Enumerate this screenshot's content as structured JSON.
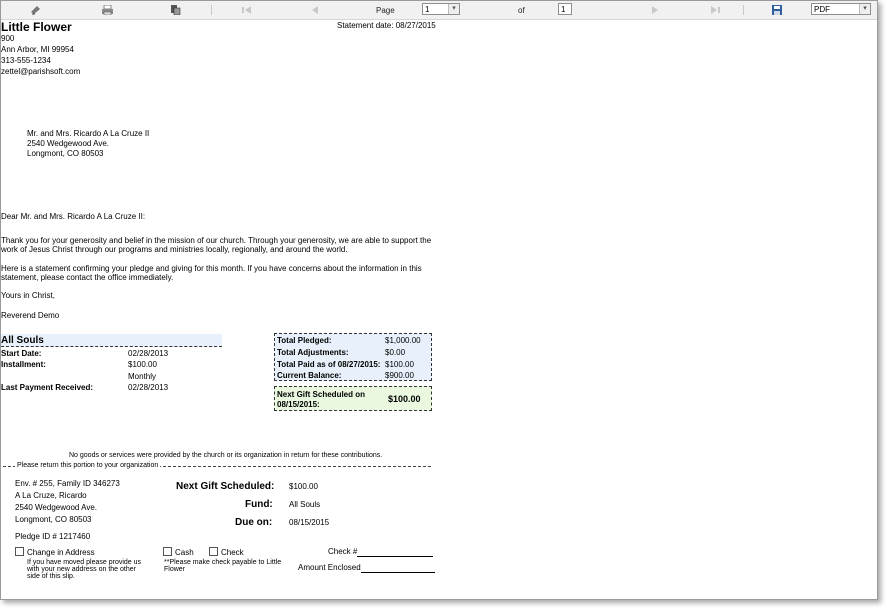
{
  "toolbar": {
    "page_label": "Page",
    "page_value": "1",
    "of_label": "of",
    "total_pages": "1",
    "export_format": "PDF"
  },
  "church": {
    "name": "Little Flower",
    "address1": "900",
    "city": "Ann Arbor, MI 99954",
    "phone": "313-555-1234",
    "email": "zettel@parishsoft.com"
  },
  "statement_date": "Statement date: 08/27/2015",
  "recipient": {
    "name": "Mr. and Mrs. Ricardo A La Cruze II",
    "street": "2540 Wedgewood Ave.",
    "city": "Longmont, CO 80503"
  },
  "letter": {
    "salutation": "Dear Mr. and Mrs. Ricardo A La Cruze II:",
    "para1_line1": "Thank you for your generosity and belief in the mission of our church. Through your generosity, we are able to support the",
    "para1_line2": "work of Jesus Christ through our programs and ministries locally, regionally, and around the world.",
    "para2_line1": "Here is a  statement confirming your pledge and giving for this month. If you have concerns about the information in this",
    "para2_line2": "statement, please contact the office immediately.",
    "closing": "Yours in Christ,",
    "signature": "Reverend Demo"
  },
  "fund_section": {
    "title": "All Souls",
    "start_date_label": "Start Date:",
    "start_date": "02/28/2013",
    "installment_label": "Installment:",
    "installment": "$100.00",
    "frequency": "Monthly",
    "last_payment_label": "Last Payment Received:",
    "last_payment": "02/28/2013"
  },
  "summary": {
    "total_pledged_label": "Total Pledged:",
    "total_pledged": "$1,000.00",
    "adjustments_label": "Total Adjustments:",
    "adjustments": "$0.00",
    "total_paid_label": "Total Paid as of 08/27/2015:",
    "total_paid": "$100.00",
    "balance_label": "Current Balance:",
    "balance": "$900.00",
    "next_gift_label_1": "Next Gift Scheduled on",
    "next_gift_label_2": "08/15/2015:",
    "next_gift": "$100.00"
  },
  "notice": "No goods or services were provided by the church or its organization in return for these contributions.",
  "tear_label": "Please return this portion to your organization",
  "slip": {
    "env": "Env. # 255, Family ID 346273",
    "name": "A La Cruze, Ricardo",
    "street": "2540 Wedgewood Ave.",
    "city": "Longmont, CO 80503",
    "pledge_id": "Pledge ID # 1217460",
    "next_gift_label": "Next Gift Scheduled:",
    "next_gift_value": "$100.00",
    "fund_label": "Fund:",
    "fund_value": "All Souls",
    "due_label": "Due on:",
    "due_value": "08/15/2015",
    "change_address": "Change in Address",
    "cash": "Cash",
    "check": "Check",
    "check_num_label": "Check #",
    "moved_note_1": "If you have moved please provide us",
    "moved_note_2": "with your new address on the other",
    "moved_note_3": "side of this slip.",
    "payable_note_1": "**Please make check payable to Little",
    "payable_note_2": "Flower",
    "amount_label": "Amount Enclosed"
  },
  "colors": {
    "summary_bg": "#e8f1fb",
    "next_gift_bg": "#eaf8e0",
    "fund_header_bg": "#e8f1fb"
  }
}
